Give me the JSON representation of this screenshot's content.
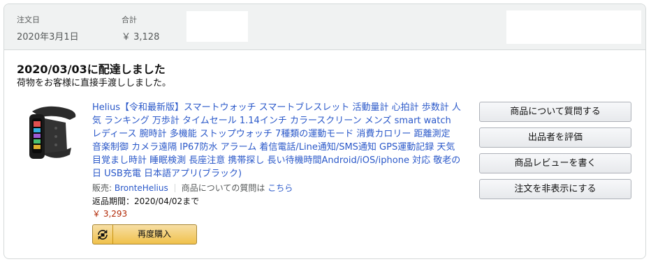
{
  "header": {
    "order_date_label": "注文日",
    "order_date_value": "2020年3月1日",
    "total_label": "合計",
    "total_value": "￥ 3,128"
  },
  "shipment": {
    "status_title": "2020/03/03に配達しました",
    "status_detail": "荷物をお客様に直接手渡ししました。"
  },
  "item": {
    "image_icon": "smartwatch-product-image",
    "title": "Helius【令和最新版】スマートウォッチ スマートブレスレット 活動量計 心拍計 歩数計 人気 ランキング 万歩計 タイムセール 1.14インチ カラースクリーン メンズ smart watch レディース 腕時計 多機能 ストップウォッチ 7種類の運動モード 消費カロリー 距離測定 音楽制御 カメラ遠隔 IP67防水 アラーム 着信電話/Line通知/SMS通知 GPS運動記録 天気 目覚まし時計 睡眠検測 長座注意 携帯探し 長い待機時間Android/iOS/iphone 対応 敬老の日 USB充電 日本語アプリ(ブラック)",
    "seller_label": "販売: ",
    "seller_name": "BronteHelius",
    "question_label": "商品についての質問は ",
    "question_link": "こちら",
    "return_window": "返品期間：2020/04/02まで",
    "price": "￥ 3,293",
    "buy_again_label": "再度購入",
    "buy_again_icon": "buy-again-icon"
  },
  "actions": [
    {
      "label": "商品について質問する"
    },
    {
      "label": "出品者を評価"
    },
    {
      "label": "商品レビューを書く"
    },
    {
      "label": "注文を非表示にする"
    }
  ],
  "colors": {
    "link": "#2a58c9",
    "price": "#b12704",
    "header_bg": "#f0f2f2",
    "buy_button": "#f0c14b"
  }
}
